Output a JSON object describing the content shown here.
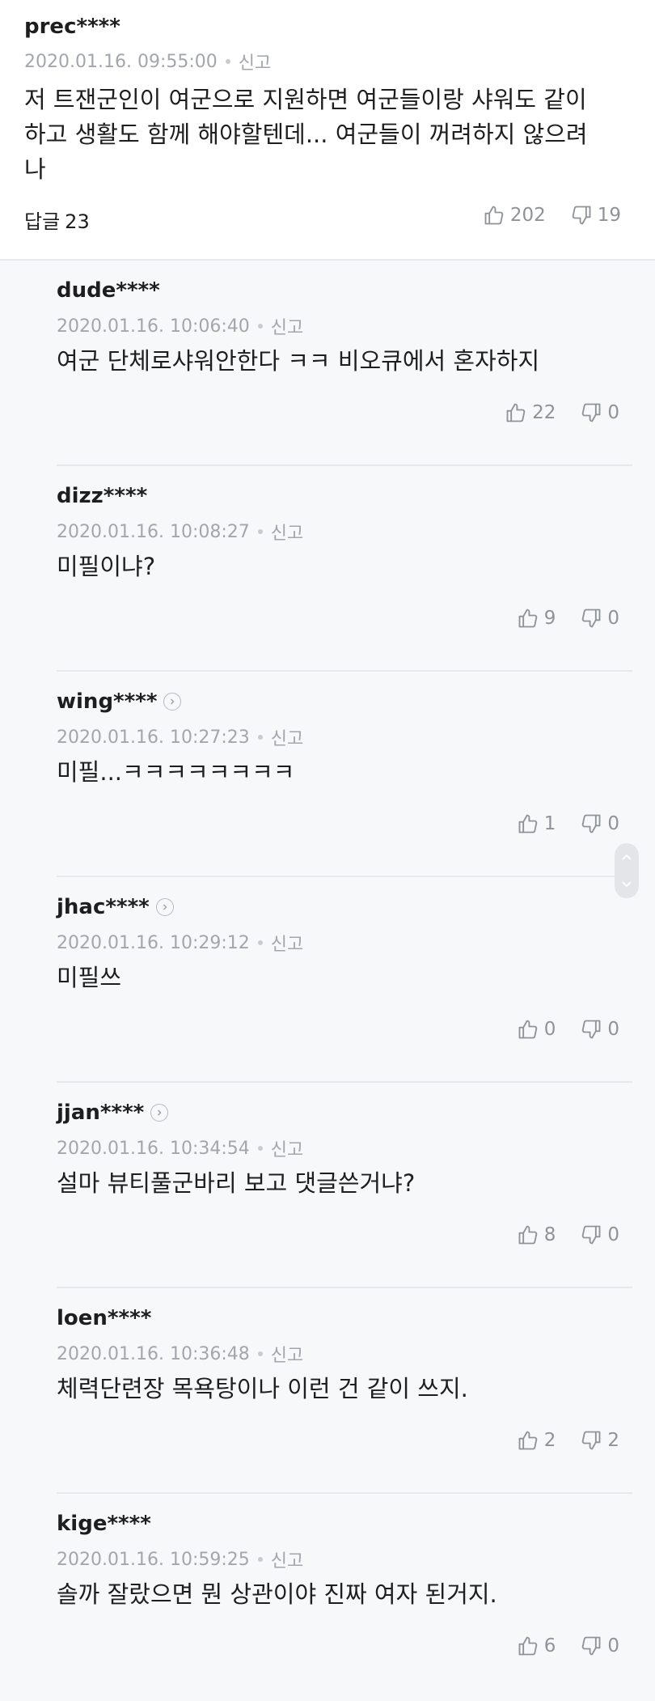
{
  "main_comment": {
    "username": "prec****",
    "date": "2020.01.16. 09:55:00",
    "report_label": "신고",
    "lines": [
      "저 트잰군인이 여군으로 지원하면 여군들이랑 샤워도 같이",
      "하고 생활도 함께 해야할텐데... 여군들이 꺼려하지 않으려",
      "나"
    ],
    "reply_label": "답글",
    "reply_count": "23",
    "likes": "202",
    "dislikes": "19"
  },
  "replies": [
    {
      "username": "dude****",
      "date": "2020.01.16. 10:06:40",
      "report_label": "신고",
      "text": "여군 단체로샤워안한다 ㅋㅋ 비오큐에서 혼자하지",
      "likes": "22",
      "dislikes": "0"
    },
    {
      "username": "dizz****",
      "date": "2020.01.16. 10:08:27",
      "report_label": "신고",
      "text": "미필이냐?",
      "likes": "9",
      "dislikes": "0"
    },
    {
      "username": "wing****",
      "date": "2020.01.16. 10:27:23",
      "report_label": "신고",
      "text": "미필...ㅋㅋㅋㅋㅋㅋㅋㅋ",
      "likes": "1",
      "dislikes": "0"
    },
    {
      "username": "jhac****",
      "date": "2020.01.16. 10:29:12",
      "report_label": "신고",
      "text": "미필쓰",
      "likes": "0",
      "dislikes": "0"
    },
    {
      "username": "jjan****",
      "date": "2020.01.16. 10:34:54",
      "report_label": "신고",
      "text": "설마 뷰티풀군바리 보고 댓글쓴거냐?",
      "likes": "8",
      "dislikes": "0"
    },
    {
      "username": "loen****",
      "date": "2020.01.16. 10:36:48",
      "report_label": "신고",
      "text": "체력단련장 목욕탕이나 이런 건 같이 쓰지.",
      "likes": "2",
      "dislikes": "2"
    },
    {
      "username": "kige****",
      "date": "2020.01.16. 10:59:25",
      "report_label": "신고",
      "text": "솔까 잘랐으면 뭔 상관이야 진짜 여자 된거지.",
      "likes": "6",
      "dislikes": "0"
    }
  ]
}
